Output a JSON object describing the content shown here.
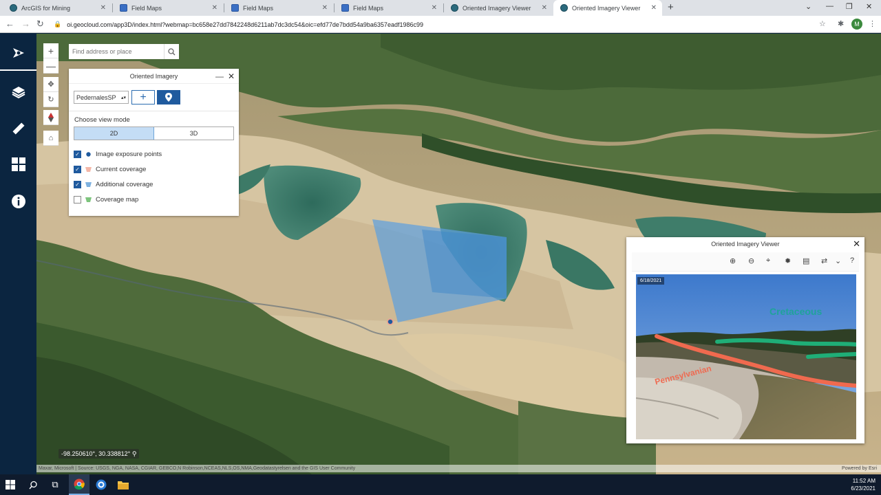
{
  "browser": {
    "tabs": [
      {
        "title": "ArcGIS for Mining",
        "active": false,
        "icon": "globe-icon"
      },
      {
        "title": "Field Maps",
        "active": false,
        "icon": "map-icon"
      },
      {
        "title": "Field Maps",
        "active": false,
        "icon": "map-icon"
      },
      {
        "title": "Field Maps",
        "active": false,
        "icon": "map-icon"
      },
      {
        "title": "Oriented Imagery Viewer",
        "active": false,
        "icon": "globe-icon"
      },
      {
        "title": "Oriented Imagery Viewer",
        "active": true,
        "icon": "globe-icon"
      }
    ],
    "url": "oi.geocloud.com/app3D/index.html?webmap=bc658e27dd7842248d6211ab7dc3dc54&oic=efd77de7bdd54a9ba6357eadf1986c99",
    "profile_initial": "M"
  },
  "sidebar": {
    "items": [
      {
        "icon": "oriented-imagery-icon",
        "selected": true
      },
      {
        "icon": "layers-icon",
        "selected": false
      },
      {
        "icon": "measure-icon",
        "selected": false
      },
      {
        "icon": "basemap-gallery-icon",
        "selected": false
      },
      {
        "icon": "info-icon",
        "selected": false
      }
    ]
  },
  "map": {
    "search_placeholder": "Find address or place",
    "coordinates": "-98.250610°, 30.338812°",
    "attribution": "Maxar, Microsoft | Source: USGS, NGA, NASA, CGIAR, GEBCO,N Robinson,NCEAS,NLS,OS,NMA,Geodatastyrelsen and the GIS User Community",
    "powered_by": "Powered by Esri"
  },
  "oi_panel": {
    "title": "Oriented Imagery",
    "layer_select": "PedernalesSP",
    "view_mode_label": "Choose view mode",
    "view_modes": [
      "2D",
      "3D"
    ],
    "active_view_mode": "2D",
    "layers": [
      {
        "label": "Image exposure points",
        "checked": true,
        "color": "#1f5a9e"
      },
      {
        "label": "Current coverage",
        "checked": true,
        "color": "#f4b7a8"
      },
      {
        "label": "Additional coverage",
        "checked": true,
        "color": "#7fb2e0"
      },
      {
        "label": "Coverage map",
        "checked": false,
        "color": "#7dc47d"
      }
    ]
  },
  "viewer": {
    "title": "Oriented Imagery Viewer",
    "toolbar_icons": [
      "zoom-in-icon",
      "zoom-out-icon",
      "center-icon",
      "brightness-icon",
      "image-enhance-icon",
      "swap-icon",
      "chevron-down-icon",
      "help-icon"
    ],
    "photo_date": "6/18/2021",
    "annotation_1": "Cretaceous",
    "annotation_2": "Pennsylvanian",
    "colors": {
      "cretaceous": "#1fa39a",
      "pennsylvanian": "#ee6b52"
    }
  },
  "taskbar": {
    "time": "11:52 AM",
    "date": "6/23/2021"
  }
}
